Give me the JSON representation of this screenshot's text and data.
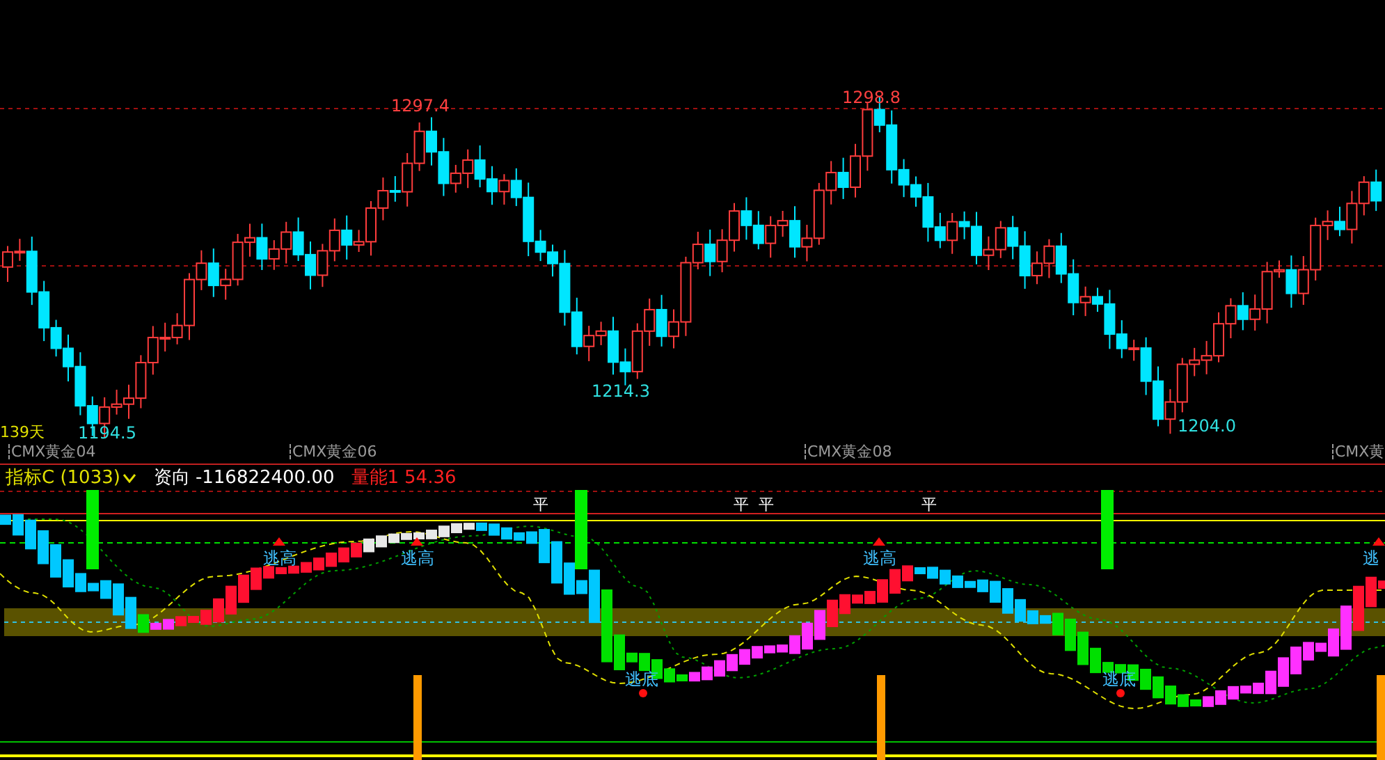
{
  "price_chart": {
    "period_label": "139天",
    "annotations": [
      {
        "text": "1297.4",
        "kind": "high"
      },
      {
        "text": "1298.8",
        "kind": "high"
      },
      {
        "text": "1214.3",
        "kind": "low"
      },
      {
        "text": "1204.0",
        "kind": "low"
      },
      {
        "text": "1194.5",
        "kind": "low"
      }
    ]
  },
  "time_axis": {
    "labels": [
      "CMX黄金04",
      "CMX黄金06",
      "CMX黄金08",
      "CMX黄"
    ]
  },
  "indicator": {
    "name": "指标C (1033)",
    "fields": [
      {
        "label": "资向",
        "value": "-116822400.00",
        "kind": "plain"
      },
      {
        "label": "量能1",
        "value": "54.36",
        "kind": "alert"
      }
    ],
    "markers": [
      {
        "text": "平",
        "kind": "flat"
      },
      {
        "text": "平",
        "kind": "flat"
      },
      {
        "text": "平",
        "kind": "flat"
      },
      {
        "text": "平",
        "kind": "flat"
      },
      {
        "text": "逃高",
        "kind": "escape_top"
      },
      {
        "text": "逃高",
        "kind": "escape_top"
      },
      {
        "text": "逃高",
        "kind": "escape_top"
      },
      {
        "text": "逃",
        "kind": "escape_top"
      },
      {
        "text": "逃底",
        "kind": "escape_bottom"
      },
      {
        "text": "逃底",
        "kind": "escape_bottom"
      }
    ]
  }
}
